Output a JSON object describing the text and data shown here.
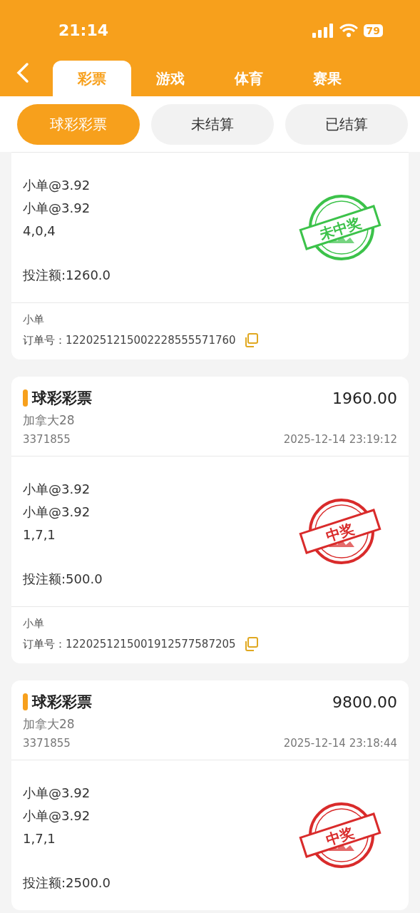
{
  "status_bar": {
    "time": "21:14",
    "battery": "79"
  },
  "tabs": [
    {
      "label": "彩票",
      "selected": true
    },
    {
      "label": "游戏",
      "selected": false
    },
    {
      "label": "体育",
      "selected": false
    },
    {
      "label": "赛果",
      "selected": false
    }
  ],
  "filters": [
    {
      "label": "球彩彩票",
      "selected": true
    },
    {
      "label": "未结算",
      "selected": false
    },
    {
      "label": "已结算",
      "selected": false
    }
  ],
  "orders": [
    {
      "picks": [
        "小单@3.92",
        "小单@3.92",
        "4,0,4"
      ],
      "stake": "投注额:1260.0",
      "result": {
        "kind": "lose",
        "label": "未中奖"
      },
      "footer": {
        "play": "小单",
        "order_no": "订单号：1220251215002228555571760"
      }
    },
    {
      "title": "球彩彩票",
      "amount": "1960.00",
      "game": "加拿大28",
      "issue": "3371855",
      "time": "2025-12-14 23:19:12",
      "picks": [
        "小单@3.92",
        "小单@3.92",
        "1,7,1"
      ],
      "stake": "投注额:500.0",
      "result": {
        "kind": "win",
        "label": "中奖"
      },
      "footer": {
        "play": "小单",
        "order_no": "订单号：1220251215001912577587205"
      }
    },
    {
      "title": "球彩彩票",
      "amount": "9800.00",
      "game": "加拿大28",
      "issue": "3371855",
      "time": "2025-12-14 23:18:44",
      "picks": [
        "小单@3.92",
        "小单@3.92",
        "1,7,1"
      ],
      "stake": "投注额:2500.0",
      "result": {
        "kind": "win",
        "label": "中奖"
      }
    }
  ]
}
